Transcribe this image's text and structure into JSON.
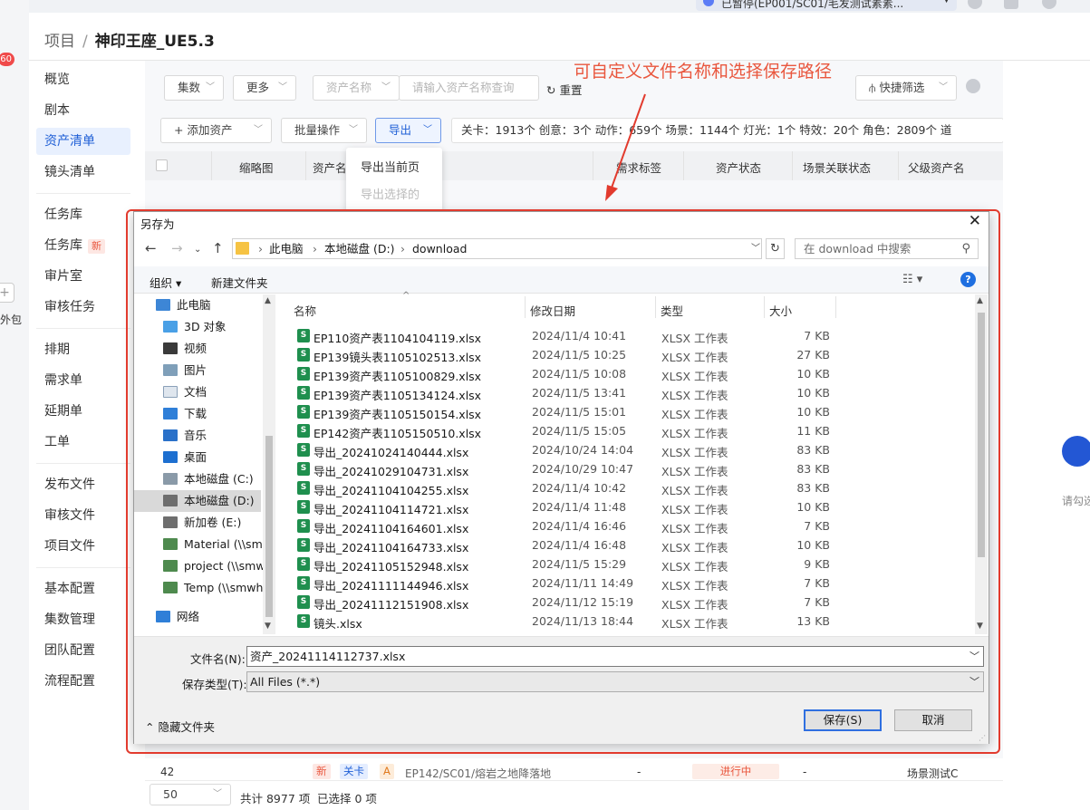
{
  "topbar": {
    "project_selector": "已暂停(EP001/SC01/毛发测试素素..."
  },
  "leftstrip": {
    "badge": "60",
    "plus": "+",
    "label": "外包"
  },
  "breadcrumb": {
    "root": "项目",
    "sep": "/",
    "current": "神印王座_UE5.3"
  },
  "sidebar": {
    "items": [
      {
        "label": "概览"
      },
      {
        "label": "剧本"
      },
      {
        "label": "资产清单",
        "active": true
      },
      {
        "label": "镜头清单"
      },
      {
        "label": "任务库"
      },
      {
        "label": "任务库",
        "tag": "新"
      },
      {
        "label": "审片室"
      },
      {
        "label": "审核任务"
      },
      {
        "label": "排期"
      },
      {
        "label": "需求单"
      },
      {
        "label": "延期单"
      },
      {
        "label": "工单"
      },
      {
        "label": "发布文件"
      },
      {
        "label": "审核文件"
      },
      {
        "label": "项目文件"
      },
      {
        "label": "基本配置"
      },
      {
        "label": "集数管理"
      },
      {
        "label": "团队配置"
      },
      {
        "label": "流程配置"
      }
    ]
  },
  "toolbar1": {
    "episodes": "集数",
    "more": "更多",
    "asset_name": "资产名称",
    "search_placeholder": "请输入资产名称查询",
    "reset": "重置",
    "quick_filter": "快捷筛选"
  },
  "toolbar2": {
    "add_asset": "+ 添加资产",
    "batch": "批量操作",
    "export": "导出",
    "stats": "关卡：1913个   创意：3个   动作：659个   场景：1144个   灯光：1个   特效：20个   角色：2809个   道"
  },
  "table": {
    "headers": [
      "缩略图",
      "资产名",
      "需求标签",
      "资产状态",
      "场景关联状态",
      "父级资产名"
    ],
    "row42": {
      "index": "42",
      "tag_new": "新",
      "tag_level": "关卡",
      "tag_a": "A",
      "path": "EP142/SC01/熔岩之地降落地",
      "req": "-",
      "status": "进行中",
      "scene": "-",
      "parent": "场景测试C"
    }
  },
  "footer": {
    "page_size": "50",
    "total": "共计 8977 项",
    "selected": "已选择 0 项"
  },
  "export_menu": {
    "current_page": "导出当前页",
    "selected": "导出选择的"
  },
  "annotation": "可自定义文件名称和选择保存路径",
  "dialog": {
    "title": "另存为",
    "close": "✕",
    "address": [
      "此电脑",
      "本地磁盘 (D:)",
      "download"
    ],
    "search_placeholder": "在 download 中搜索",
    "organize": "组织 ▾",
    "new_folder": "新建文件夹",
    "tree": [
      {
        "label": "此电脑",
        "icon": "pc-icon",
        "level": 1
      },
      {
        "label": "3D 对象",
        "icon": "3d-objects-icon",
        "level": 2
      },
      {
        "label": "视频",
        "icon": "video-icon",
        "level": 2
      },
      {
        "label": "图片",
        "icon": "pictures-icon",
        "level": 2
      },
      {
        "label": "文档",
        "icon": "documents-icon",
        "level": 2
      },
      {
        "label": "下载",
        "icon": "download-icon",
        "level": 2
      },
      {
        "label": "音乐",
        "icon": "music-icon",
        "level": 2
      },
      {
        "label": "桌面",
        "icon": "desktop-icon",
        "level": 2
      },
      {
        "label": "本地磁盘 (C:)",
        "icon": "drive-icon",
        "level": 2
      },
      {
        "label": "本地磁盘 (D:)",
        "icon": "drive-icon",
        "level": 2,
        "selected": true
      },
      {
        "label": "新加卷 (E:)",
        "icon": "drive-icon",
        "level": 2
      },
      {
        "label": "Material (\\\\smw",
        "icon": "network-drive-icon",
        "level": 2
      },
      {
        "label": "project (\\\\smw",
        "icon": "network-drive-icon",
        "level": 2
      },
      {
        "label": "Temp (\\\\smwh.",
        "icon": "network-drive-icon",
        "level": 2
      },
      {
        "label": "网络",
        "icon": "network-icon",
        "level": 1
      }
    ],
    "columns": [
      "名称",
      "修改日期",
      "类型",
      "大小"
    ],
    "files": [
      {
        "name": "EP110资产表1104104119.xlsx",
        "date": "2024/11/4 10:41",
        "type": "XLSX 工作表",
        "size": "7 KB"
      },
      {
        "name": "EP139镜头表1105102513.xlsx",
        "date": "2024/11/5 10:25",
        "type": "XLSX 工作表",
        "size": "27 KB"
      },
      {
        "name": "EP139资产表1105100829.xlsx",
        "date": "2024/11/5 10:08",
        "type": "XLSX 工作表",
        "size": "10 KB"
      },
      {
        "name": "EP139资产表1105134124.xlsx",
        "date": "2024/11/5 13:41",
        "type": "XLSX 工作表",
        "size": "10 KB"
      },
      {
        "name": "EP139资产表1105150154.xlsx",
        "date": "2024/11/5 15:01",
        "type": "XLSX 工作表",
        "size": "10 KB"
      },
      {
        "name": "EP142资产表1105150510.xlsx",
        "date": "2024/11/5 15:05",
        "type": "XLSX 工作表",
        "size": "11 KB"
      },
      {
        "name": "导出_20241024140444.xlsx",
        "date": "2024/10/24 14:04",
        "type": "XLSX 工作表",
        "size": "83 KB"
      },
      {
        "name": "导出_20241029104731.xlsx",
        "date": "2024/10/29 10:47",
        "type": "XLSX 工作表",
        "size": "83 KB"
      },
      {
        "name": "导出_20241104104255.xlsx",
        "date": "2024/11/4 10:42",
        "type": "XLSX 工作表",
        "size": "83 KB"
      },
      {
        "name": "导出_20241104114721.xlsx",
        "date": "2024/11/4 11:48",
        "type": "XLSX 工作表",
        "size": "10 KB"
      },
      {
        "name": "导出_20241104164601.xlsx",
        "date": "2024/11/4 16:46",
        "type": "XLSX 工作表",
        "size": "7 KB"
      },
      {
        "name": "导出_20241104164733.xlsx",
        "date": "2024/11/4 16:48",
        "type": "XLSX 工作表",
        "size": "10 KB"
      },
      {
        "name": "导出_20241105152948.xlsx",
        "date": "2024/11/5 15:29",
        "type": "XLSX 工作表",
        "size": "9 KB"
      },
      {
        "name": "导出_20241111144946.xlsx",
        "date": "2024/11/11 14:49",
        "type": "XLSX 工作表",
        "size": "7 KB"
      },
      {
        "name": "导出_20241112151908.xlsx",
        "date": "2024/11/12 15:19",
        "type": "XLSX 工作表",
        "size": "7 KB"
      },
      {
        "name": "镜头.xlsx",
        "date": "2024/11/13 18:44",
        "type": "XLSX 工作表",
        "size": "13 KB"
      }
    ],
    "filename_label": "文件名(N):",
    "filename_value": "资产_20241114112737.xlsx",
    "filetype_label": "保存类型(T):",
    "filetype_value": "All Files (*.*)",
    "hide_folders": "隐藏文件夹",
    "save": "保存(S)",
    "cancel": "取消"
  },
  "right_panel": {
    "text": "请勾选"
  },
  "colors": {
    "accent": "#1f5fd6",
    "annotation_red": "#e23b2e",
    "excel_green": "#1f8f4e"
  }
}
